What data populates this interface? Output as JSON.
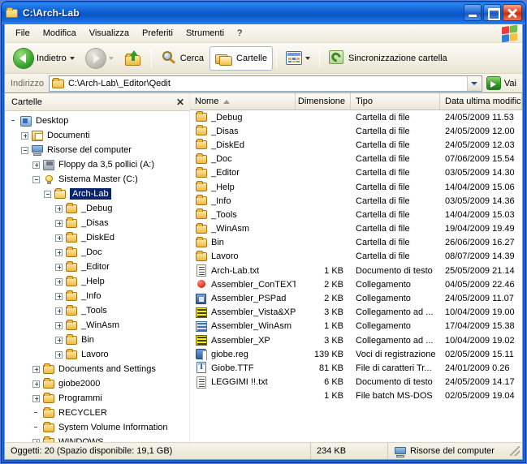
{
  "window": {
    "title": "C:\\Arch-Lab",
    "title_icon": "folder-icon",
    "minimize_label": "_",
    "maximize_label": "□",
    "close_label": "✕"
  },
  "menubar": {
    "items": [
      {
        "label": "File"
      },
      {
        "label": "Modifica"
      },
      {
        "label": "Visualizza"
      },
      {
        "label": "Preferiti"
      },
      {
        "label": "Strumenti"
      },
      {
        "label": "?"
      }
    ],
    "logo": "windows-flag-logo"
  },
  "toolbar": {
    "back_label": "Indietro",
    "back_icon": "back-arrow-icon",
    "forward_icon": "forward-arrow-icon",
    "up_icon": "up-folder-icon",
    "search_label": "Cerca",
    "search_icon": "search-icon",
    "folders_label": "Cartelle",
    "folders_icon": "folders-icon",
    "views_icon": "views-icon",
    "sync_label": "Sincronizzazione cartella",
    "sync_icon": "sync-icon"
  },
  "addressbar": {
    "label": "Indirizzo",
    "icon": "folder-icon",
    "value": "C:\\Arch-Lab\\_Editor\\Qedit",
    "dropdown_icon": "chevron-down-icon",
    "go_label": "Vai",
    "go_icon": "go-arrow-icon"
  },
  "tree": {
    "header": "Cartelle",
    "close_label": "✕",
    "nodes": [
      {
        "label": "Desktop",
        "indent": 0,
        "toggle": "none",
        "icon": "desktop-icon",
        "selected": false
      },
      {
        "label": "Documenti",
        "indent": 1,
        "toggle": "plus",
        "icon": "documents-icon",
        "selected": false
      },
      {
        "label": "Risorse del computer",
        "indent": 1,
        "toggle": "minus",
        "icon": "my-computer-icon",
        "selected": false
      },
      {
        "label": "Floppy da 3,5 pollici (A:)",
        "indent": 2,
        "toggle": "plus",
        "icon": "floppy-icon",
        "selected": false
      },
      {
        "label": "Sistema Master (C:)",
        "indent": 2,
        "toggle": "minus",
        "icon": "harddisk-icon",
        "selected": false
      },
      {
        "label": "Arch-Lab",
        "indent": 3,
        "toggle": "minus",
        "icon": "folder-open-icon",
        "selected": true
      },
      {
        "label": "_Debug",
        "indent": 4,
        "toggle": "plus",
        "icon": "folder-icon",
        "selected": false
      },
      {
        "label": "_Disas",
        "indent": 4,
        "toggle": "plus",
        "icon": "folder-icon",
        "selected": false
      },
      {
        "label": "_DiskEd",
        "indent": 4,
        "toggle": "plus",
        "icon": "folder-icon",
        "selected": false
      },
      {
        "label": "_Doc",
        "indent": 4,
        "toggle": "plus",
        "icon": "folder-icon",
        "selected": false
      },
      {
        "label": "_Editor",
        "indent": 4,
        "toggle": "plus",
        "icon": "folder-icon",
        "selected": false
      },
      {
        "label": "_Help",
        "indent": 4,
        "toggle": "plus",
        "icon": "folder-icon",
        "selected": false
      },
      {
        "label": "_Info",
        "indent": 4,
        "toggle": "plus",
        "icon": "folder-icon",
        "selected": false
      },
      {
        "label": "_Tools",
        "indent": 4,
        "toggle": "plus",
        "icon": "folder-icon",
        "selected": false
      },
      {
        "label": "_WinAsm",
        "indent": 4,
        "toggle": "plus",
        "icon": "folder-icon",
        "selected": false
      },
      {
        "label": "Bin",
        "indent": 4,
        "toggle": "plus",
        "icon": "folder-icon",
        "selected": false
      },
      {
        "label": "Lavoro",
        "indent": 4,
        "toggle": "plus",
        "icon": "folder-icon",
        "selected": false
      },
      {
        "label": "Documents and Settings",
        "indent": 2,
        "toggle": "plus",
        "icon": "folder-icon",
        "selected": false
      },
      {
        "label": "giobe2000",
        "indent": 2,
        "toggle": "plus",
        "icon": "folder-icon",
        "selected": false
      },
      {
        "label": "Programmi",
        "indent": 2,
        "toggle": "plus",
        "icon": "folder-icon",
        "selected": false
      },
      {
        "label": "RECYCLER",
        "indent": 2,
        "toggle": "none",
        "icon": "folder-icon",
        "selected": false
      },
      {
        "label": "System Volume Information",
        "indent": 2,
        "toggle": "none",
        "icon": "folder-icon",
        "selected": false
      },
      {
        "label": "WINDOWS",
        "indent": 2,
        "toggle": "plus",
        "icon": "folder-icon",
        "selected": false
      }
    ]
  },
  "filelist": {
    "columns": [
      {
        "label": "Nome",
        "sorted": true
      },
      {
        "label": "Dimensione",
        "sorted": false
      },
      {
        "label": "Tipo",
        "sorted": false
      },
      {
        "label": "Data ultima modifica",
        "sorted": false
      }
    ],
    "sort_indicator": "sort-ascending-icon",
    "rows": [
      {
        "name": "_Debug",
        "size": "",
        "type": "Cartella di file",
        "date": "24/05/2009 11.53",
        "icon": "folder-icon"
      },
      {
        "name": "_Disas",
        "size": "",
        "type": "Cartella di file",
        "date": "24/05/2009 12.00",
        "icon": "folder-icon"
      },
      {
        "name": "_DiskEd",
        "size": "",
        "type": "Cartella di file",
        "date": "24/05/2009 12.03",
        "icon": "folder-icon"
      },
      {
        "name": "_Doc",
        "size": "",
        "type": "Cartella di file",
        "date": "07/06/2009 15.54",
        "icon": "folder-icon"
      },
      {
        "name": "_Editor",
        "size": "",
        "type": "Cartella di file",
        "date": "03/05/2009 14.30",
        "icon": "folder-icon"
      },
      {
        "name": "_Help",
        "size": "",
        "type": "Cartella di file",
        "date": "14/04/2009 15.06",
        "icon": "folder-icon"
      },
      {
        "name": "_Info",
        "size": "",
        "type": "Cartella di file",
        "date": "03/05/2009 14.36",
        "icon": "folder-icon"
      },
      {
        "name": "_Tools",
        "size": "",
        "type": "Cartella di file",
        "date": "14/04/2009 15.03",
        "icon": "folder-icon"
      },
      {
        "name": "_WinAsm",
        "size": "",
        "type": "Cartella di file",
        "date": "19/04/2009 19.49",
        "icon": "folder-icon"
      },
      {
        "name": "Bin",
        "size": "",
        "type": "Cartella di file",
        "date": "26/06/2009 16.27",
        "icon": "folder-icon"
      },
      {
        "name": "Lavoro",
        "size": "",
        "type": "Cartella di file",
        "date": "08/07/2009 14.39",
        "icon": "folder-icon"
      },
      {
        "name": "Arch-Lab.txt",
        "size": "1 KB",
        "type": "Documento di testo",
        "date": "25/05/2009 21.14",
        "icon": "text-file-icon"
      },
      {
        "name": "Assembler_ConTEXT",
        "size": "2 KB",
        "type": "Collegamento",
        "date": "04/05/2009 22.46",
        "icon": "context-shortcut-icon"
      },
      {
        "name": "Assembler_PSPad",
        "size": "2 KB",
        "type": "Collegamento",
        "date": "24/05/2009 11.07",
        "icon": "pspad-shortcut-icon"
      },
      {
        "name": "Assembler_Vista&XP",
        "size": "3 KB",
        "type": "Collegamento ad ...",
        "date": "10/04/2009 19.00",
        "icon": "asm-yellow-icon"
      },
      {
        "name": "Assembler_WinAsm",
        "size": "1 KB",
        "type": "Collegamento",
        "date": "17/04/2009 15.38",
        "icon": "asm-blue-icon"
      },
      {
        "name": "Assembler_XP",
        "size": "3 KB",
        "type": "Collegamento ad ...",
        "date": "10/04/2009 19.02",
        "icon": "asm-yellow-icon"
      },
      {
        "name": "giobe.reg",
        "size": "139 KB",
        "type": "Voci di registrazione",
        "date": "02/05/2009 15.11",
        "icon": "registry-file-icon"
      },
      {
        "name": "Giobe.TTF",
        "size": "81 KB",
        "type": "File di caratteri Tr...",
        "date": "24/01/2009 0.26",
        "icon": "truetype-font-icon"
      },
      {
        "name": "LEGGIMI !!.txt",
        "size": "6 KB",
        "type": "Documento di testo",
        "date": "24/05/2009 14.17",
        "icon": "text-file-icon"
      },
      {
        "name": "",
        "size": "1 KB",
        "type": "File batch MS-DOS",
        "date": "02/05/2009 19.04",
        "icon": "blank-icon"
      }
    ]
  },
  "statusbar": {
    "objects": "Oggetti: 20 (Spazio disponibile: 19,1 GB)",
    "size": "234 KB",
    "location": "Risorse del computer",
    "location_icon": "my-computer-icon"
  }
}
